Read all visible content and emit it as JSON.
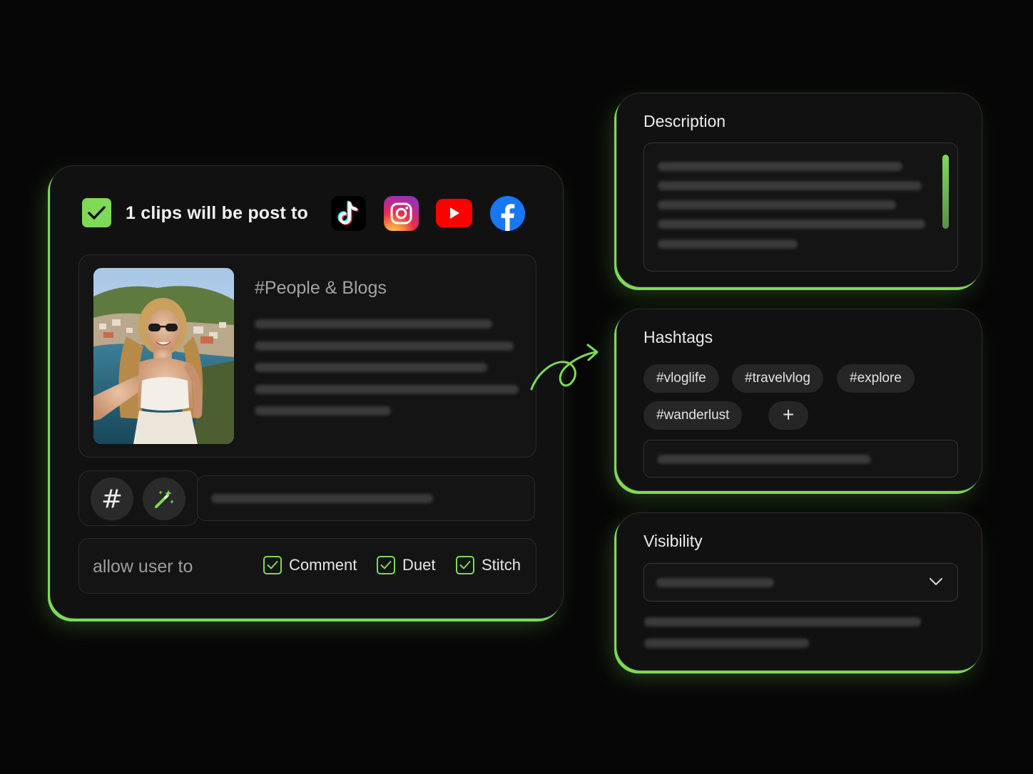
{
  "post_panel": {
    "title": "1 clips will be post to",
    "platforms": [
      {
        "name": "TikTok",
        "icon": "tiktok-icon"
      },
      {
        "name": "Instagram",
        "icon": "instagram-icon"
      },
      {
        "name": "YouTube",
        "icon": "youtube-icon"
      },
      {
        "name": "Facebook",
        "icon": "facebook-icon"
      }
    ],
    "category": "#People & Blogs",
    "tools": {
      "hashtag_symbol": "#",
      "magic_icon": "magic-wand-icon"
    },
    "allow_label": "allow user to",
    "options": [
      {
        "label": "Comment",
        "checked": true
      },
      {
        "label": "Duet",
        "checked": true
      },
      {
        "label": "Stitch",
        "checked": true
      }
    ]
  },
  "description_panel": {
    "title": "Description"
  },
  "hashtags_panel": {
    "title": "Hashtags",
    "tags": [
      "#vloglife",
      "#travelvlog",
      "#explore",
      "#wanderlust"
    ],
    "add_symbol": "+"
  },
  "visibility_panel": {
    "title": "Visibility",
    "dropdown_icon": "chevron-down-icon"
  },
  "colors": {
    "accent": "#7ed957",
    "background": "#060606",
    "card": "#111111"
  }
}
